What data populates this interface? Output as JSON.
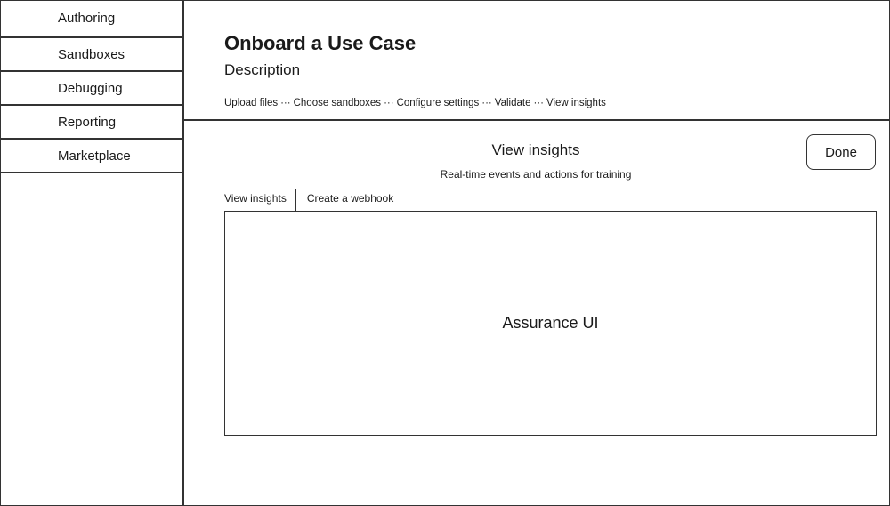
{
  "sidebar": {
    "items": [
      {
        "label": "Authoring"
      },
      {
        "label": "Sandboxes"
      },
      {
        "label": "Debugging"
      },
      {
        "label": "Reporting"
      },
      {
        "label": "Marketplace"
      }
    ]
  },
  "header": {
    "title": "Onboard a Use Case",
    "description": "Description",
    "steps": [
      {
        "label": "Upload files"
      },
      {
        "label": "Choose sandboxes"
      },
      {
        "label": "Configure settings"
      },
      {
        "label": "Validate"
      },
      {
        "label": "View insights"
      }
    ],
    "step_separator": "···"
  },
  "main": {
    "title": "View insights",
    "subtitle": "Real-time events and actions for training",
    "done_label": "Done",
    "tabs": [
      {
        "label": "View insights"
      },
      {
        "label": "Create a webhook"
      }
    ],
    "content_label": "Assurance UI"
  }
}
